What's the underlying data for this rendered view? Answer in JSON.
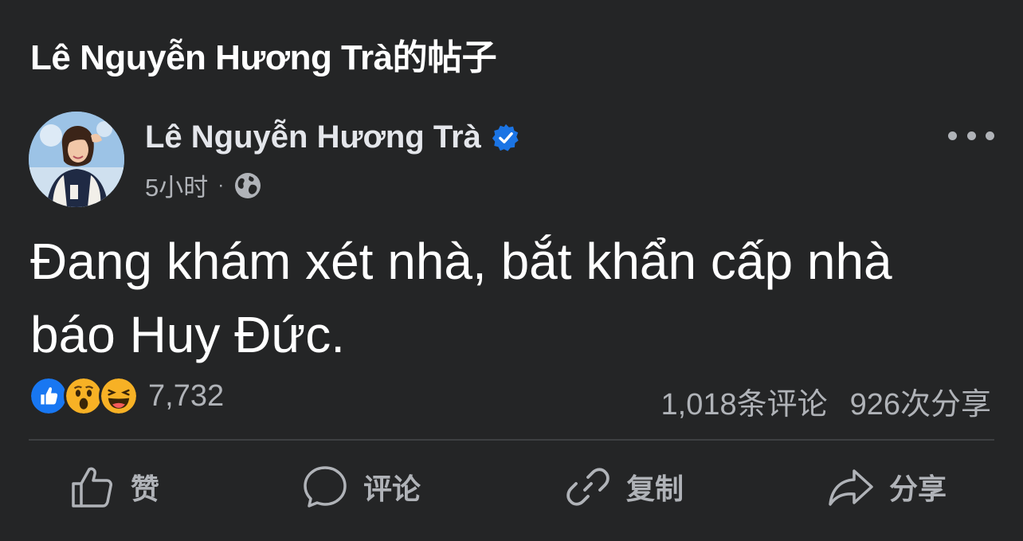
{
  "header": {
    "title": "Lê Nguyễn Hương Trà的帖子"
  },
  "post": {
    "author": "Lê Nguyễn Hương Trà",
    "verified": true,
    "time": "5小时",
    "separator": "·",
    "audience_icon": "globe-icon",
    "text": "Đang khám xét nhà, bắt khẩn cấp nhà báo Huy Đức."
  },
  "reactions": {
    "types": [
      "like-reaction-icon",
      "wow-reaction-icon",
      "haha-reaction-icon"
    ],
    "count": "7,732"
  },
  "stats": {
    "comments": "1,018条评论",
    "shares": "926次分享"
  },
  "actions": {
    "like": "赞",
    "comment": "评论",
    "copy": "复制",
    "share": "分享"
  },
  "colors": {
    "background": "#242526",
    "text": "#e4e6eb",
    "secondary": "#b0b3b8",
    "verified_blue": "#1b74e4",
    "like_blue": "#1877f2",
    "emoji_yellow": "#f7b125",
    "divider": "#3e4042"
  }
}
